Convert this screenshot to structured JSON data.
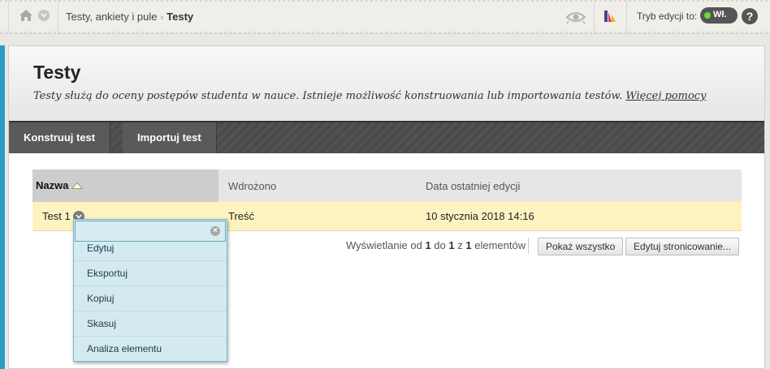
{
  "breadcrumb": {
    "parent": "Testy, ankiety i pule",
    "separator": "›",
    "current": "Testy"
  },
  "edit_mode": {
    "label": "Tryb edycji to:",
    "state": "Wł."
  },
  "help_label": "?",
  "header": {
    "title": "Testy",
    "description": "Testy służą do oceny postępów studenta w nauce. Istnieje możliwość konstruowania lub importowania testów.",
    "more_help": "Więcej pomocy"
  },
  "actions": {
    "build": "Konstruuj test",
    "import": "Importuj test"
  },
  "table": {
    "columns": [
      "Nazwa",
      "Wdrożono",
      "Data ostatniej edycji"
    ],
    "rows": [
      {
        "name": "Test 1",
        "deployed": "Treść",
        "last_edited": "10 stycznia 2018 14:16"
      }
    ]
  },
  "paging": {
    "prefix": "Wyświetlanie od",
    "from": "1",
    "to_word": "do",
    "to": "1",
    "of_word": "z",
    "total": "1",
    "suffix": "elementów",
    "show_all": "Pokaż wszystko",
    "edit_paging": "Edytuj stronicowanie..."
  },
  "context_menu": {
    "items": [
      "Edytuj",
      "Eksportuj",
      "Kopiuj",
      "Skasuj",
      "Analiza elementu"
    ]
  },
  "colors": {
    "accent_bar": "#2f9ac0",
    "row_highlight": "#fdf3c1",
    "menu_bg": "#d4eaf1",
    "toggle_on": "#66dd33"
  }
}
